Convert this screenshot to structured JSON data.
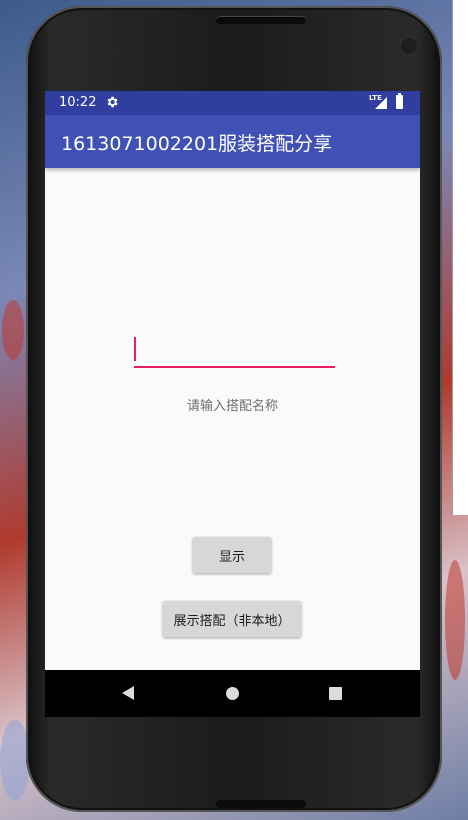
{
  "status_bar": {
    "time": "10:22",
    "settings_icon": "gear-icon",
    "network_label": "LTE",
    "signal_icon": "signal-icon",
    "battery_icon": "battery-icon"
  },
  "app_bar": {
    "title": "1613071002201服装搭配分享"
  },
  "form": {
    "input_value": "",
    "hint": "请输入搭配名称",
    "show_button": "显示",
    "gallery_button": "展示搭配（非本地）"
  },
  "nav_bar": {
    "back_icon": "back-triangle-icon",
    "home_icon": "home-circle-icon",
    "recents_icon": "recents-square-icon"
  },
  "colors": {
    "status_bar": "#303f9f",
    "app_bar": "#3f51b5",
    "accent": "#e91e63",
    "background": "#fafafa",
    "button": "#d6d7d7"
  }
}
